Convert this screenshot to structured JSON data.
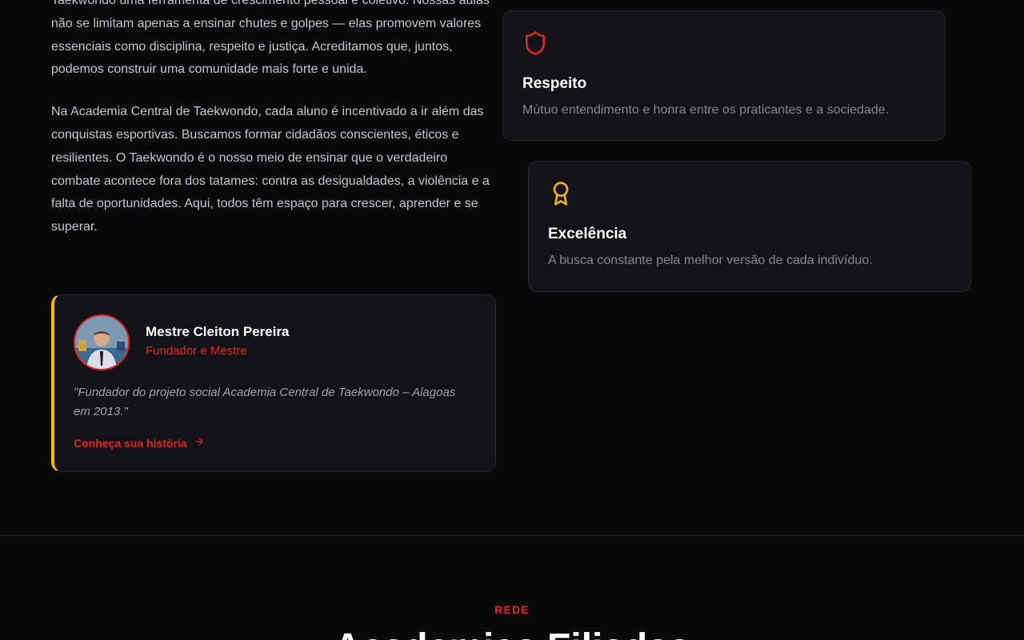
{
  "about": {
    "paragraph_1": "Taekwondo uma ferramenta de crescimento pessoal e coletivo. Nossas aulas não se limitam apenas a ensinar chutes e golpes — elas promovem valores essenciais como disciplina, respeito e justiça. Acreditamos que, juntos, podemos construir uma comunidade mais forte e unida.",
    "paragraph_2": "Na Academia Central de Taekwondo, cada aluno é incentivado a ir além das conquistas esportivas. Buscamos formar cidadãos conscientes, éticos e resilientes. O Taekwondo é o nosso meio de ensinar que o verdadeiro combate acontece fora dos tatames: contra as desigualdades, a violência e a falta de oportunidades. Aqui, todos têm espaço para crescer, aprender e se superar."
  },
  "values": [
    {
      "icon": "shield-icon",
      "icon_color": "#dc2626",
      "title": "Respeito",
      "description": "Mútuo entendimento e honra entre os praticantes e a sociedade."
    },
    {
      "icon": "award-icon",
      "icon_color": "#f5b400",
      "title": "Excelência",
      "description": "A busca constante pela melhor versão de cada indivíduo."
    }
  ],
  "founder": {
    "name": "Mestre Cleiton Pereira",
    "role": "Fundador e Mestre",
    "quote": "\"Fundador do projeto social Academia Central de Taekwondo – Alagoas em 2013.\"",
    "link_label": "Conheça sua história",
    "accent_color": "#f5b400"
  },
  "network_section": {
    "eyebrow": "REDE",
    "heading": "Academias Filiadas"
  },
  "colors": {
    "background": "#0a0a0c",
    "card": "#131317",
    "primary_red": "#dc2626",
    "gold": "#f5b400"
  }
}
